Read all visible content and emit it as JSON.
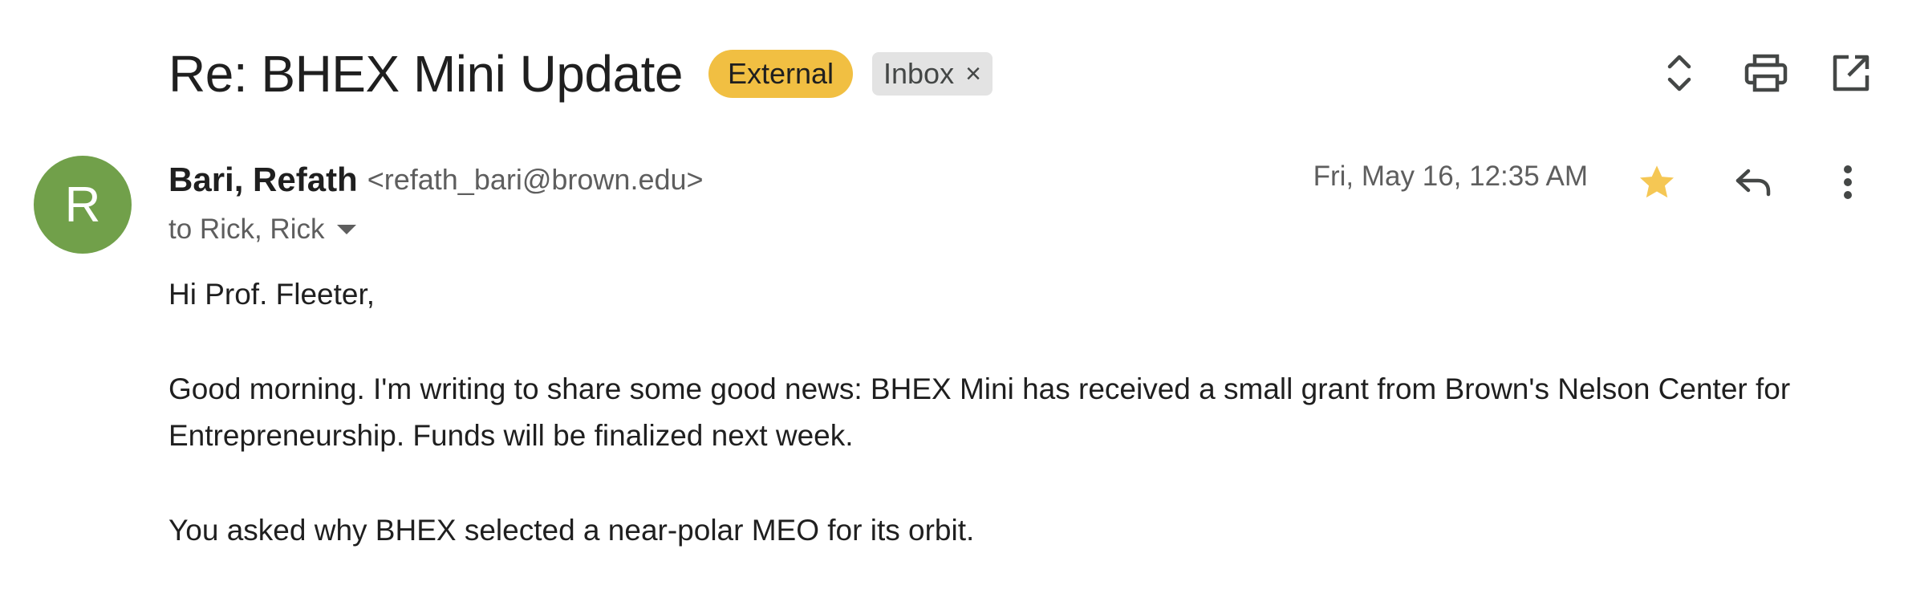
{
  "email": {
    "subject": "Re: BHEX Mini Update",
    "labels": {
      "external": "External",
      "inbox": "Inbox",
      "remove_symbol": "×"
    },
    "sender": {
      "avatar_letter": "R",
      "avatar_color": "#71a04a",
      "name": "Bari, Refath",
      "email": "<refath_bari@brown.edu>"
    },
    "recipients": "to Rick, Rick",
    "date": "Fri, May 16, 12:35 AM",
    "starred": true,
    "body": {
      "greeting": "Hi Prof. Fleeter,",
      "paragraph1": "Good morning. I'm writing to share some good news: BHEX Mini has received a small grant from Brown's Nelson Center for Entrepreneurship. Funds will be finalized next week.",
      "paragraph2": "You asked why BHEX selected a near-polar MEO for its orbit."
    }
  },
  "toolbar": {
    "icons": [
      "expand-collapse-icon",
      "print-icon",
      "open-in-new-window-icon"
    ]
  },
  "actions": {
    "icons": [
      "star-icon",
      "reply-icon",
      "more-options-icon"
    ]
  },
  "colors": {
    "external_badge": "#f1bf42",
    "inbox_badge": "#e3e3e3",
    "star": "#f5c754",
    "text_primary": "#1f1f1f",
    "text_secondary": "#5e5e5e"
  }
}
